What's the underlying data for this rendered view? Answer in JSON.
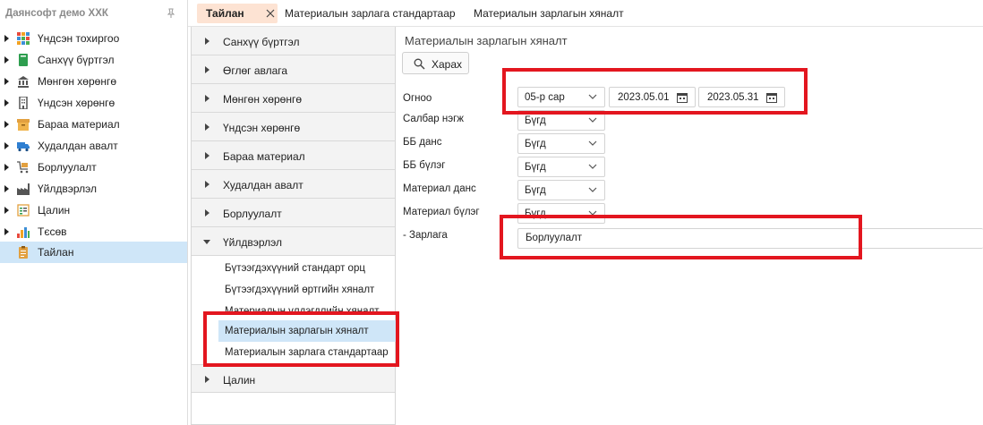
{
  "sidebar": {
    "company": "Даянсофт демо ХХК",
    "items": [
      {
        "label": "Үндсэн тохиргоо",
        "icon": "grid-icon"
      },
      {
        "label": "Санхүү бүртгэл",
        "icon": "book-icon"
      },
      {
        "label": "Мөнгөн хөрөнгө",
        "icon": "bank-icon"
      },
      {
        "label": "Үндсэн хөрөнгө",
        "icon": "building-icon"
      },
      {
        "label": "Бараа материал",
        "icon": "box-icon"
      },
      {
        "label": "Худалдан авалт",
        "icon": "truck-icon"
      },
      {
        "label": "Борлуулалт",
        "icon": "cart-icon"
      },
      {
        "label": "Үйлдвэрлэл",
        "icon": "factory-icon"
      },
      {
        "label": "Цалин",
        "icon": "payroll-icon"
      },
      {
        "label": "Тєсөв",
        "icon": "bar-chart-icon"
      },
      {
        "label": "Тайлан",
        "icon": "clipboard-icon"
      }
    ]
  },
  "tabs": [
    {
      "label": "Тайлан"
    },
    {
      "label": "Материалын зарлага стандартаар"
    },
    {
      "label": "Материалын зарлагын хяналт"
    }
  ],
  "menu": {
    "sections": [
      {
        "label": "Санхүү бүртгэл"
      },
      {
        "label": "Өглөг авлага"
      },
      {
        "label": "Мөнгөн хөрөнгө"
      },
      {
        "label": "Үндсэн хөрөнгө"
      },
      {
        "label": "Бараа материал"
      },
      {
        "label": "Худалдан авалт"
      },
      {
        "label": "Борлуулалт"
      },
      {
        "label": "Үйлдвэрлэл"
      },
      {
        "label": "Цалин"
      }
    ],
    "sub_items": [
      {
        "label": "Бүтээгдэхүүний стандарт орц"
      },
      {
        "label": "Бүтээгдэхүүний өртгийн хяналт"
      },
      {
        "label": "Материалын үлдэгдлийн хяналт"
      },
      {
        "label": "Материалын зарлагын хяналт"
      },
      {
        "label": "Материалын зарлага стандартаар"
      }
    ]
  },
  "form": {
    "title": "Материалын зарлагын хяналт",
    "view_button": "Харах",
    "period_label": "Огноо",
    "period_value": "05-р сар",
    "date_from": "2023.05.01",
    "date_to": "2023.05.31",
    "fields": [
      {
        "label": "Салбар нэгж",
        "value": "Бүгд"
      },
      {
        "label": "ББ данс",
        "value": "Бүгд"
      },
      {
        "label": "ББ бүлэг",
        "value": "Бүгд"
      },
      {
        "label": "Материал данс",
        "value": "Бүгд"
      },
      {
        "label": "Материал бүлэг",
        "value": "Бүгд"
      }
    ],
    "expense_label": "- Зарлага",
    "expense_value": "Борлуулалт"
  },
  "colors": {
    "highlight": "#e3161f",
    "selected": "#cfe6f8",
    "active_tab": "#fde3d3"
  }
}
